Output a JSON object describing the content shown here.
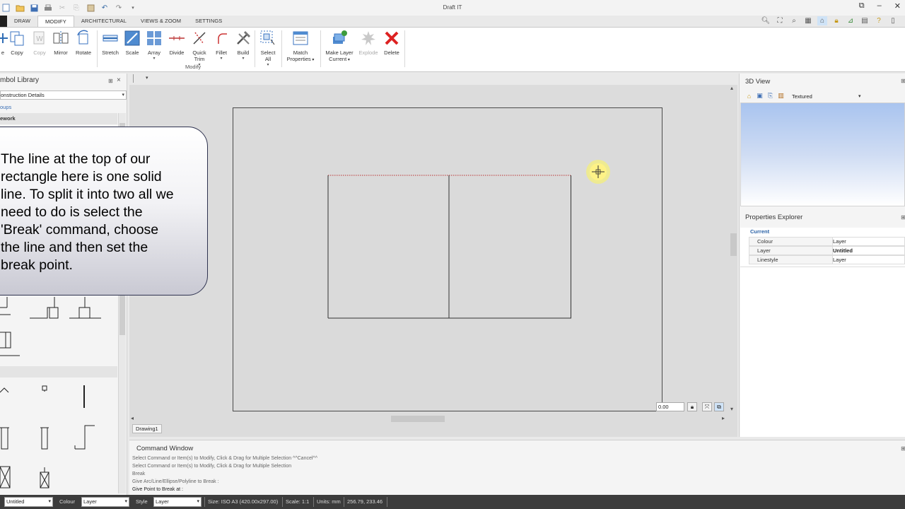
{
  "app": {
    "title": "Draft IT",
    "window_controls": {
      "restore": "⧉",
      "minimize": "–",
      "close": "✕"
    }
  },
  "quick_access": [
    "new-icon",
    "open-icon",
    "save-icon",
    "print-icon",
    "cut-icon",
    "copy-icon",
    "paste-icon",
    "undo-icon",
    "redo-icon",
    "customize-icon"
  ],
  "tabs": [
    {
      "label": "DRAW"
    },
    {
      "label": "MODIFY"
    },
    {
      "label": "ARCHITECTURAL"
    },
    {
      "label": "VIEWS & ZOOM"
    },
    {
      "label": "SETTINGS"
    }
  ],
  "ribbon": {
    "group_label": "Modify",
    "buttons": {
      "copy": "Copy",
      "copy_disabled": "Copy",
      "mirror": "Mirror",
      "rotate": "Rotate",
      "stretch": "Stretch",
      "scale": "Scale",
      "array": "Array",
      "divide": "Divide",
      "quick_trim_1": "Quick",
      "quick_trim_2": "Trim",
      "fillet": "Fillet",
      "build": "Build",
      "select_all_1": "Select",
      "select_all_2": "All",
      "match_properties_1": "Match",
      "match_properties_2": "Properties",
      "make_layer_current_1": "Make Layer",
      "make_layer_current_2": "Current",
      "explode": "Explode",
      "delete": "Delete"
    }
  },
  "symbol_library": {
    "title": "mbol Library",
    "category_select": "onstruction Details",
    "groups_link": "oups",
    "section_header": "ework"
  },
  "callout": {
    "lines": [
      "The line at the top of our",
      "rectangle here is one solid",
      "line. To split it into two all we",
      "need to do is select the",
      "'Break' command, choose",
      "the line and then set the",
      "break point."
    ]
  },
  "drawing": {
    "zoom_value": "0.00",
    "doc_tab": "Drawing1"
  },
  "view3d": {
    "title": "3D View",
    "mode": "Textured"
  },
  "properties": {
    "title": "Properties Explorer",
    "section": "Current",
    "rows": [
      {
        "key": "Colour",
        "value": "Layer",
        "bold": false
      },
      {
        "key": "Layer",
        "value": "Untitled",
        "bold": true
      },
      {
        "key": "Linestyle",
        "value": "Layer",
        "bold": false
      }
    ]
  },
  "command_window": {
    "title": "Command Window",
    "lines": [
      "Select Command or Item(s) to Modify, Click & Drag for Multiple Selection  ^^Cancel^^",
      "Select Command or Item(s) to Modify, Click & Drag for Multiple Selection",
      "Break",
      "Give Arc/Line/Ellipse/Polyline to Break :",
      "Give Point to Break at :"
    ]
  },
  "status_bar": {
    "layer_select": "Untitled",
    "colour_label": "Colour",
    "colour_select": "Layer",
    "style_label": "Style",
    "style_select": "Layer",
    "size": "Size: ISO A3 (420.00x297.00)",
    "scale": "Scale: 1:1",
    "units": "Units: mm",
    "coords": "256.79, 233.46"
  }
}
